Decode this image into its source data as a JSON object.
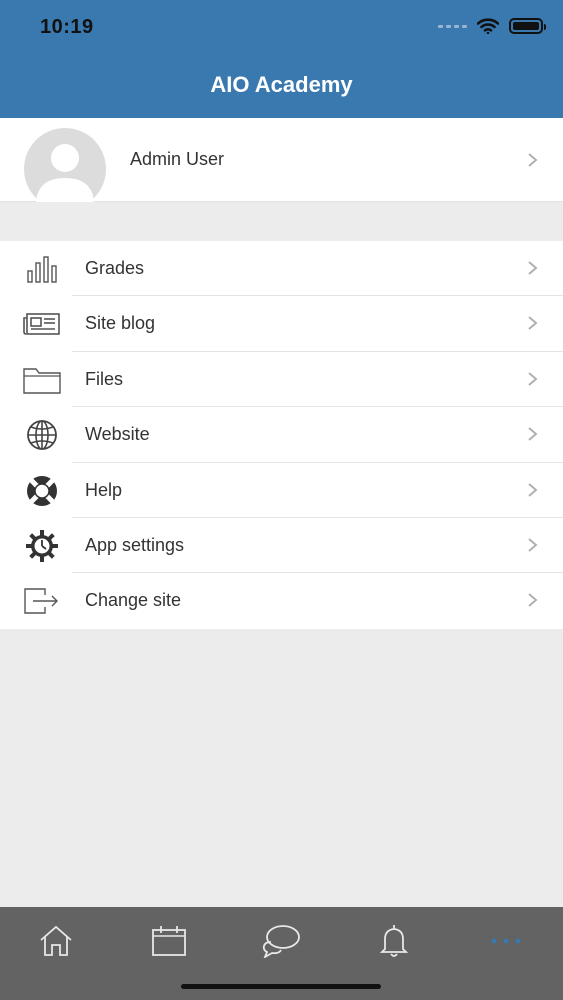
{
  "status_bar": {
    "time": "10:19"
  },
  "header": {
    "title": "AIO Academy"
  },
  "user": {
    "name": "Admin User"
  },
  "menu": {
    "items": [
      {
        "label": "Grades",
        "icon": "bar-chart-icon"
      },
      {
        "label": "Site blog",
        "icon": "newspaper-icon"
      },
      {
        "label": "Files",
        "icon": "folder-icon"
      },
      {
        "label": "Website",
        "icon": "globe-icon"
      },
      {
        "label": "Help",
        "icon": "lifebuoy-icon"
      },
      {
        "label": "App settings",
        "icon": "gear-icon"
      },
      {
        "label": "Change site",
        "icon": "exit-icon"
      }
    ]
  },
  "tabbar": {
    "tabs": [
      {
        "icon": "home-icon"
      },
      {
        "icon": "calendar-icon"
      },
      {
        "icon": "chat-icon"
      },
      {
        "icon": "bell-icon"
      },
      {
        "icon": "more-icon",
        "active": true
      }
    ]
  },
  "colors": {
    "header": "#3a78b0",
    "tabbar": "#636363",
    "active_tab": "#3a78b0",
    "background": "#ececec"
  }
}
